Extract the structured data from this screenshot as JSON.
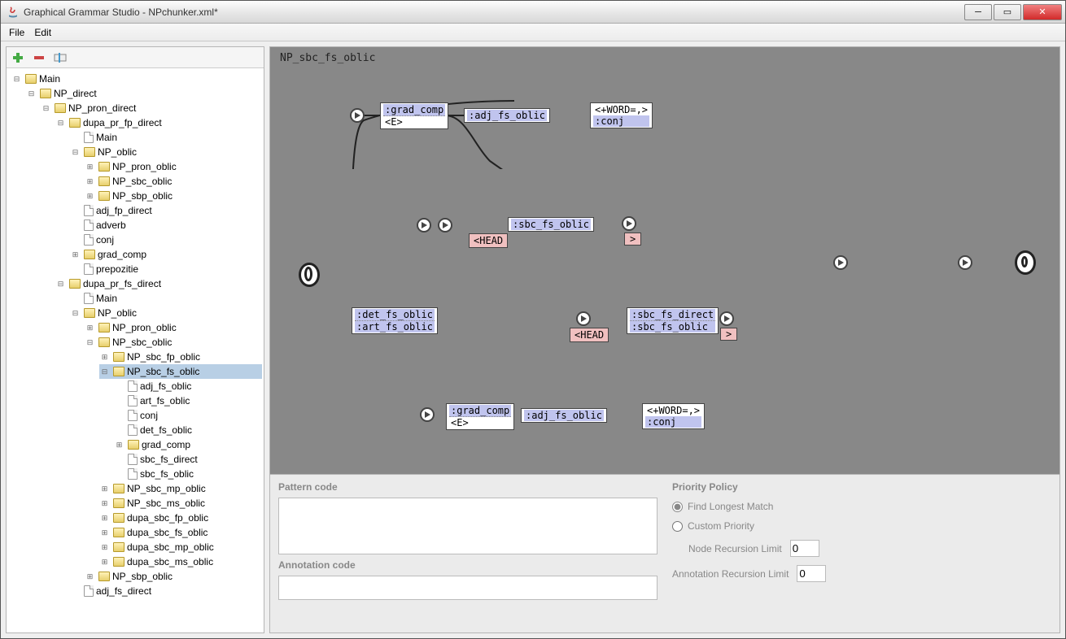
{
  "window": {
    "title": "Graphical Grammar Studio - NPchunker.xml*"
  },
  "menu": {
    "file": "File",
    "edit": "Edit"
  },
  "toolbar": {
    "add": "add-icon",
    "remove": "remove-icon",
    "rename": "rename-icon"
  },
  "tree": {
    "root": "Main",
    "n0": "NP_direct",
    "n1": "NP_pron_direct",
    "n2": "dupa_pr_fp_direct",
    "n2a": "Main",
    "n3": "NP_oblic",
    "n3a": "NP_pron_oblic",
    "n3b": "NP_sbc_oblic",
    "n3c": "NP_sbp_oblic",
    "n4": "adj_fp_direct",
    "n5": "adverb",
    "n6": "conj",
    "n7": "grad_comp",
    "n8": "prepozitie",
    "n9": "dupa_pr_fs_direct",
    "n9a": "Main",
    "n10": "NP_oblic",
    "n10a": "NP_pron_oblic",
    "n11": "NP_sbc_oblic",
    "n11a": "NP_sbc_fp_oblic",
    "n11b": "NP_sbc_fs_oblic",
    "leaf_a": "adj_fs_oblic",
    "leaf_b": "art_fs_oblic",
    "leaf_c": "conj",
    "leaf_d": "det_fs_oblic",
    "leaf_e": "grad_comp",
    "leaf_f": "sbc_fs_direct",
    "leaf_g": "sbc_fs_oblic",
    "n12": "NP_sbc_mp_oblic",
    "n13": "NP_sbc_ms_oblic",
    "n14": "dupa_sbc_fp_oblic",
    "n15": "dupa_sbc_fs_oblic",
    "n16": "dupa_sbc_mp_oblic",
    "n17": "dupa_sbc_ms_oblic",
    "n18": "NP_sbp_oblic",
    "n19": "adj_fs_direct"
  },
  "canvas": {
    "title": "NP_sbc_fs_oblic",
    "nodes": {
      "grad1_a": ":grad_comp",
      "grad1_b": "<E>",
      "adj1": ":adj_fs_oblic",
      "word1_a": "<+WORD=,>",
      "word1_b": ":conj",
      "sbc1": ":sbc_fs_oblic",
      "head1": "<HEAD",
      "head2": "<HEAD",
      "gt1": ">",
      "gt2": ">",
      "det_a": ":det_fs_oblic",
      "det_b": ":art_fs_oblic",
      "sbc2_a": ":sbc_fs_direct",
      "sbc2_b": ":sbc_fs_oblic",
      "grad2_a": ":grad_comp",
      "grad2_b": "<E>",
      "adj2": ":adj_fs_oblic",
      "word2_a": "<+WORD=,>",
      "word2_b": ":conj"
    }
  },
  "bottom": {
    "pattern_label": "Pattern code",
    "annotation_label": "Annotation code",
    "priority_label": "Priority Policy",
    "radio_longest": "Find Longest Match",
    "radio_custom": "Custom Priority",
    "node_limit_label": "Node Recursion Limit",
    "node_limit_value": "0",
    "ann_limit_label": "Annotation Recursion Limit",
    "ann_limit_value": "0"
  }
}
